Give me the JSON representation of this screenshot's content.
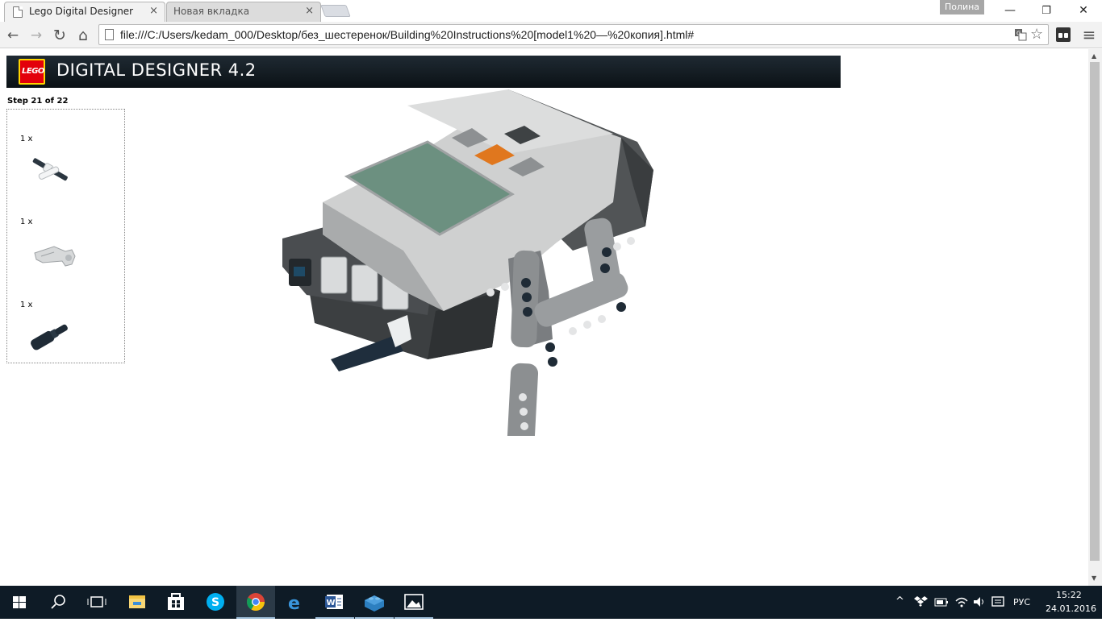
{
  "browser": {
    "tabs": [
      {
        "title": "Lego Digital Designer",
        "close": "×"
      },
      {
        "title": "Новая вкладка",
        "close": "×"
      }
    ],
    "profile_name": "Полина",
    "window_controls": {
      "minimize": "—",
      "restore": "❐",
      "close": "✕"
    },
    "nav": {
      "back": "←",
      "forward": "→",
      "reload": "↻",
      "home": "⌂"
    },
    "url": "file:///C:/Users/kedam_000/Desktop/без_шестеренок/Building%20Instructions%20[model1%20—%20копия].html#",
    "translate_icon": "translate-icon",
    "star_icon": "☆",
    "menu_icon": "≡"
  },
  "page": {
    "app_title": "DIGITAL DESIGNER 4.2",
    "logo_text": "LEGO",
    "step": "Step 21 of 22",
    "parts": [
      {
        "qty": "1 x",
        "icon": "axle-pin-part"
      },
      {
        "qty": "1 x",
        "icon": "angle-connector-part"
      },
      {
        "qty": "1 x",
        "icon": "bush-pin-part"
      }
    ],
    "model_icon": "nxt-brick-model",
    "colors": {
      "header_dark": "#0b1115",
      "lego_red": "#e3000b",
      "lego_yellow": "#ffd500",
      "brick_light": "#cfd0d0",
      "brick_dark": "#515456",
      "screen_green": "#6c9080",
      "button_orange": "#e0771e"
    }
  },
  "taskbar": {
    "apps": [
      "start-icon",
      "search-icon",
      "task-view-icon",
      "file-explorer-icon",
      "store-icon",
      "skype-icon",
      "chrome-icon",
      "edge-icon",
      "word-icon",
      "ldd-icon",
      "photos-icon"
    ],
    "lang": "РУС",
    "time": "15:22",
    "date": "24.01.2016"
  }
}
